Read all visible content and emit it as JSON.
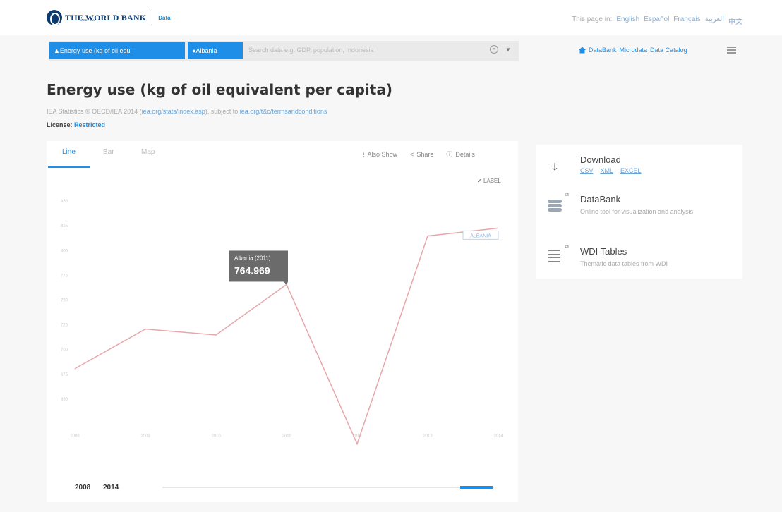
{
  "header": {
    "logo_text": "THE WORLD BANK",
    "logo_sub": "IBRD · IDA",
    "logo_section": "Data",
    "page_in_label": "This page in:",
    "languages": [
      "English",
      "Español",
      "Français",
      "العربية",
      "中文"
    ]
  },
  "search": {
    "indicator_chip": "Energy use (kg of oil equi",
    "country_chip": "Albania",
    "placeholder": "Search data e.g. GDP, population, Indonesia"
  },
  "nav": {
    "links": [
      "DataBank",
      "Microdata",
      "Data Catalog"
    ]
  },
  "page": {
    "title": "Energy use (kg of oil equivalent per capita)",
    "source_text": "IEA Statistics © OECD/IEA 2014 (",
    "source_link1": "iea.org/stats/index.asp",
    "source_mid": "), subject to ",
    "source_link2": "iea.org/t&c/termsandconditions",
    "license_label": "License:",
    "license_value": "Restricted"
  },
  "chart_panel": {
    "tabs": [
      "Line",
      "Bar",
      "Map"
    ],
    "active_tab": "Line",
    "tools": [
      "Also Show",
      "Share",
      "Details"
    ],
    "label_toggle": "LABEL"
  },
  "chart_data": {
    "type": "line",
    "series": [
      {
        "name": "Albania",
        "x": [
          2008,
          2009,
          2010,
          2011,
          2012,
          2013,
          2014
        ],
        "values": [
          680,
          720,
          714,
          764.969,
          604,
          814,
          822
        ]
      }
    ],
    "yticks": [
      650,
      675,
      700,
      725,
      750,
      775,
      800,
      825,
      850
    ],
    "ylim": [
      625,
      860
    ],
    "xlim": [
      2008,
      2014
    ],
    "tooltip": {
      "title": "Albania (2011)",
      "value": "764.969"
    },
    "series_label": "ALBANIA",
    "line_color": "#e8a6ab"
  },
  "range": {
    "start": "2008",
    "end": "2014"
  },
  "sidebar": {
    "download_title": "Download",
    "download_links": [
      "CSV",
      "XML",
      "EXCEL"
    ],
    "databank_title": "DataBank",
    "databank_desc": "Online tool for visualization and analysis",
    "wdi_title": "WDI Tables",
    "wdi_desc": "Thematic data tables from WDI"
  }
}
